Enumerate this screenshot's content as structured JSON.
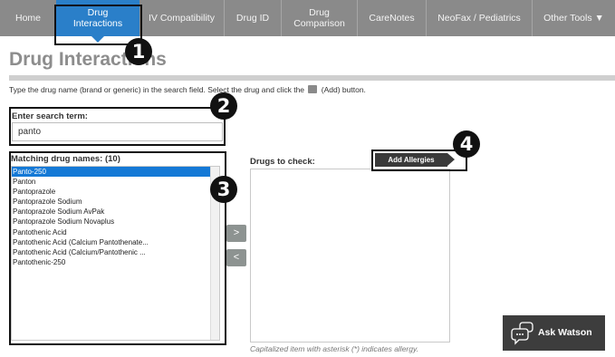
{
  "nav": {
    "tabs": [
      {
        "label": "Home"
      },
      {
        "line1": "Drug",
        "line2": "Interactions"
      },
      {
        "label": "IV Compatibility"
      },
      {
        "label": "Drug ID"
      },
      {
        "line1": "Drug",
        "line2": "Comparison"
      },
      {
        "label": "CareNotes"
      },
      {
        "label": "NeoFax / Pediatrics"
      },
      {
        "label": "Other Tools ▼"
      }
    ]
  },
  "page": {
    "title": "Drug Interactions",
    "instruction_before": "Type the drug name (brand or generic) in the search field. Select the drug and click the",
    "instruction_after": "(Add) button."
  },
  "search": {
    "label": "Enter search term:",
    "value": "panto"
  },
  "matches": {
    "label": "Matching drug names: (10)",
    "items": [
      "Panto-250",
      "Panton",
      "Pantoprazole",
      "Pantoprazole Sodium",
      "Pantoprazole Sodium AvPak",
      "Pantoprazole Sodium Novaplus",
      "Pantothenic Acid",
      "Pantothenic Acid (Calcium Pantothenate...",
      "Pantothenic Acid (Calcium/Pantothenic ...",
      "Pantothenic-250"
    ]
  },
  "buttons": {
    "add": ">",
    "remove": "<",
    "add_allergies": "Add Allergies"
  },
  "check": {
    "label": "Drugs to check:",
    "note": "Capitalized item with asterisk (*) indicates allergy."
  },
  "watson": {
    "label": "Ask Watson"
  },
  "callouts": [
    "1",
    "2",
    "3",
    "4"
  ],
  "colors": {
    "nav_bg": "#8a8a8a",
    "active_tab": "#2a7fc9",
    "selection": "#1479d6",
    "callout": "#111111"
  }
}
